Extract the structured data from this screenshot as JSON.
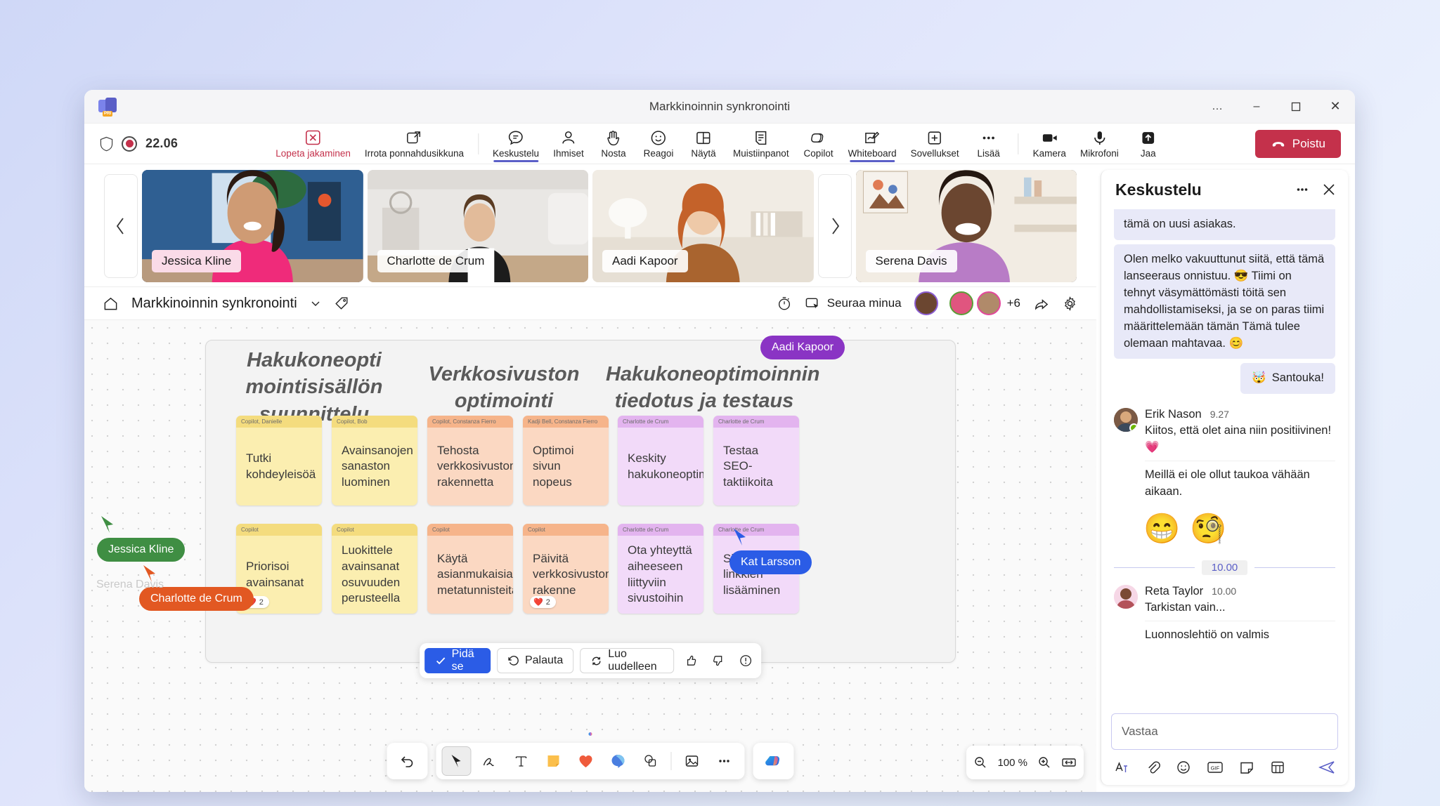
{
  "window": {
    "title": "Markkinoinnin synkronointi",
    "app_icon": "teams-icon",
    "badge": "PRI",
    "more_label": "…",
    "minimize_label": "–",
    "maximize_label": "❐",
    "close_label": "✕"
  },
  "meeting_bar": {
    "timer": "22.06",
    "shield_icon": "shield-icon",
    "record_icon": "record-icon",
    "left_actions": [
      {
        "label": "Lopeta jakaminen",
        "icon": "stop-sharing-icon",
        "danger": true
      },
      {
        "label": "Irrota ponnahdusikkuna",
        "icon": "popout-icon",
        "danger": false
      }
    ],
    "center_actions": [
      {
        "label": "Keskustelu",
        "icon": "chat-icon",
        "active": true
      },
      {
        "label": "Ihmiset",
        "icon": "people-icon",
        "active": false
      },
      {
        "label": "Nosta",
        "icon": "raise-hand-icon",
        "active": false
      },
      {
        "label": "Reagoi",
        "icon": "reactions-icon",
        "active": false
      },
      {
        "label": "Näytä",
        "icon": "view-icon",
        "active": false
      },
      {
        "label": "Muistiinpanot",
        "icon": "notes-icon",
        "active": false
      },
      {
        "label": "Copilot",
        "icon": "copilot-icon",
        "active": false
      },
      {
        "label": "Whiteboard",
        "icon": "whiteboard-icon",
        "active": true
      },
      {
        "label": "Sovellukset",
        "icon": "apps-icon",
        "active": false
      },
      {
        "label": "Lisää",
        "icon": "more-icon",
        "active": false
      }
    ],
    "right_actions": [
      {
        "label": "Kamera",
        "icon": "camera-icon"
      },
      {
        "label": "Mikrofoni",
        "icon": "microphone-icon"
      },
      {
        "label": "Jaa",
        "icon": "share-icon"
      }
    ],
    "leave_label": "Poistu",
    "leave_icon": "hangup-icon",
    "leave_color": "#c4314b"
  },
  "gallery": {
    "prev_icon": "chevron-left-icon",
    "next_icon": "chevron-right-icon",
    "tiles": [
      {
        "name": "Jessica Kline",
        "speaking": false
      },
      {
        "name": "Charlotte de Crum",
        "speaking": false
      },
      {
        "name": "Aadi Kapoor",
        "speaking": false
      },
      {
        "name": "Serena Davis",
        "speaking": true
      }
    ]
  },
  "whiteboard_header": {
    "home_icon": "home-icon",
    "title": "Markkinoinnin synkronointi",
    "chevron_icon": "chevron-down-icon",
    "tag_icon": "tag-icon",
    "timer_icon": "timer-icon",
    "follow_icon": "follow-me-icon",
    "follow_label": "Seuraa minua",
    "overflow_count": "+6",
    "share_icon": "share-board-icon",
    "settings_icon": "gear-icon"
  },
  "board": {
    "columns": [
      "Hakukoneopti mointisisällön suunnittelu",
      "Verkkosivuston optimointi",
      "Hakukoneoptimoinnin tiedotus ja testaus"
    ],
    "notes": [
      {
        "author": "Copilot, Danielle",
        "text": "Tutki kohdeyleisöä",
        "color": "yellow",
        "reactions": ""
      },
      {
        "author": "Copilot, Bob",
        "text": "Avainsanojen sanaston luominen",
        "color": "yellow",
        "reactions": ""
      },
      {
        "author": "Copilot",
        "text": "Priorisoi avainsanat",
        "color": "yellow",
        "reactions": "2"
      },
      {
        "author": "Copilot",
        "text": "Luokittele avainsanat osuvuuden perusteella",
        "color": "yellow",
        "reactions": ""
      },
      {
        "author": "Copilot, Constanza Fierro",
        "text": "Tehosta verkkosivuston rakennetta",
        "color": "orange",
        "reactions": ""
      },
      {
        "author": "Kadji Bell, Constanza Fierro",
        "text": "Optimoi sivun nopeus",
        "color": "orange",
        "reactions": ""
      },
      {
        "author": "Copilot",
        "text": "Käytä asianmukaisia metatunnisteita",
        "color": "orange",
        "reactions": ""
      },
      {
        "author": "Copilot",
        "text": "Päivitä verkkosivuston rakenne",
        "color": "orange",
        "reactions": "2"
      },
      {
        "author": "Charlotte de Crum",
        "text": "Keskity hakukoneoptimointiin",
        "color": "violet",
        "reactions": ""
      },
      {
        "author": "Charlotte de Crum",
        "text": "Testaa SEO-taktiikoita",
        "color": "violet",
        "reactions": ""
      },
      {
        "author": "Charlotte de Crum",
        "text": "Ota yhteyttä aiheeseen liittyviin sivustoihin",
        "color": "violet",
        "reactions": ""
      },
      {
        "author": "Charlotte de Crum",
        "text": "Sisäisten linkkien lisääminen",
        "color": "violet",
        "reactions": ""
      }
    ],
    "cursors": [
      {
        "name": "Jessica Kline",
        "color": "#3f8e43"
      },
      {
        "name": "Charlotte de Crum",
        "color": "#e25822"
      },
      {
        "name": "Kat Larsson",
        "color": "#2b5ce6"
      },
      {
        "name": "Aadi Kapoor",
        "color": "#8a34c4"
      },
      {
        "name": "Serena Davis",
        "color": "#bdbdbd"
      }
    ]
  },
  "copilot_bar": {
    "keep_label": "Pidä se",
    "keep_icon": "check-icon",
    "undo_label": "Palauta",
    "undo_icon": "revert-icon",
    "regen_label": "Luo uudelleen",
    "regen_icon": "regenerate-icon",
    "like_icon": "thumbs-up-icon",
    "dislike_icon": "thumbs-down-icon",
    "feedback_icon": "feedback-icon"
  },
  "tools": {
    "undo_icon": "undo-icon",
    "items": [
      {
        "icon": "select-arrow-icon",
        "selected": true
      },
      {
        "icon": "pen-icon",
        "selected": false
      },
      {
        "icon": "text-icon",
        "selected": false
      },
      {
        "icon": "sticky-note-icon",
        "selected": false
      },
      {
        "icon": "reaction-heart-icon",
        "selected": false
      },
      {
        "icon": "shape-icon",
        "selected": false
      },
      {
        "icon": "duplicate-icon",
        "selected": false
      },
      {
        "icon": "image-icon",
        "selected": false
      },
      {
        "icon": "more-icon",
        "selected": false
      }
    ],
    "copilot_icon": "copilot-icon"
  },
  "zoom_controls": {
    "zoom_out_icon": "zoom-out-icon",
    "level": "100 %",
    "zoom_in_icon": "zoom-in-icon",
    "fit_icon": "fit-to-screen-icon"
  },
  "chat": {
    "title": "Keskustelu",
    "more_icon": "more-icon",
    "close_icon": "close-icon",
    "partial_message": "tämä on uusi asiakas.",
    "long_message": "Olen melko vakuuttunut siitä, että tämä lanseeraus onnistuu. 😎 Tiimi on tehnyt väsymättömästi töitä sen mahdollistamiseksi, ja se on paras tiimi määrittelemään tämän Tämä tulee olemaan mahtavaa. 😊",
    "reaction_message": "Santouka!",
    "reaction_emoji": "🤯",
    "messages": [
      {
        "author": "Erik Nason",
        "time": "9.27",
        "text": "Kiitos, että olet aina niin positiivinen! 💗",
        "followup": "Meillä ei ole ollut taukoa vähään aikaan."
      }
    ],
    "emoji_row": [
      "😁",
      "🧐"
    ],
    "time_separator": "10.00",
    "last_message": {
      "author": "Reta Taylor",
      "time": "10.00",
      "text": "Tarkistan vain...",
      "followup": "Luonnoslehtiö on valmis"
    },
    "compose_placeholder": "Vastaa",
    "compose_tools": [
      "format-icon",
      "attach-icon",
      "emoji-icon",
      "gif-icon",
      "sticker-icon",
      "loop-icon"
    ],
    "send_icon": "send-icon"
  }
}
